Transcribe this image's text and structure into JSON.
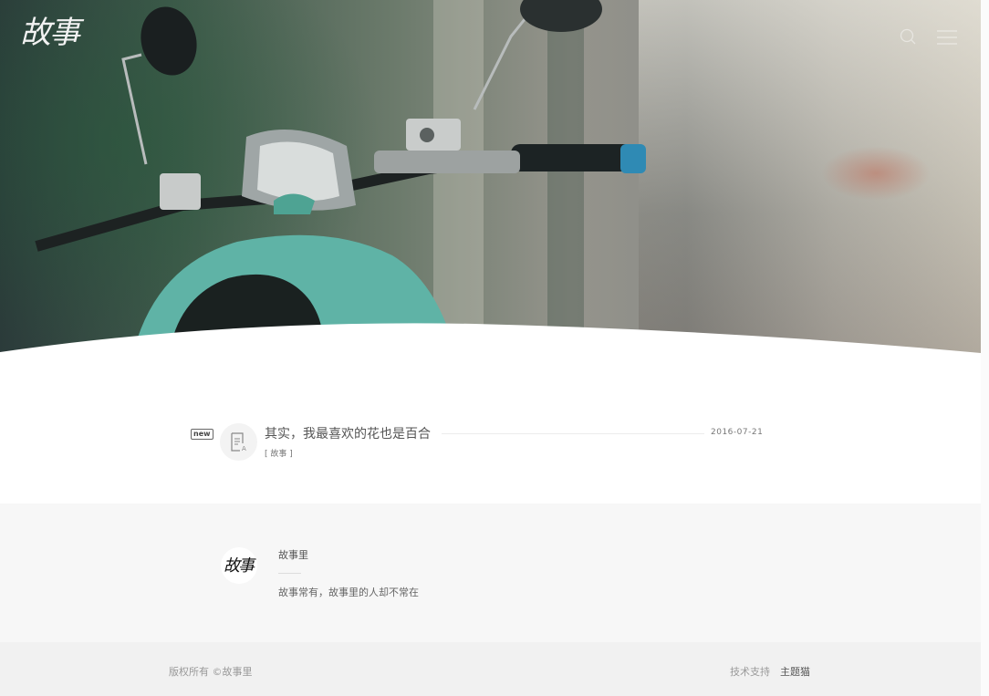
{
  "header": {
    "logo_text": "故事",
    "icons": [
      "search-icon",
      "menu-icon"
    ]
  },
  "post": {
    "badge": "new",
    "title": "其实，我最喜欢的花也是百合",
    "date": "2016-07-21",
    "category": "[ 故事 ]",
    "icon": "article-icon"
  },
  "author": {
    "avatar_text": "故事",
    "name": "故事里",
    "description": "故事常有，故事里的人却不常在"
  },
  "footer": {
    "copyright": "版权所有 ©故事里",
    "support_label": "技术支持",
    "support_link": "主题猫"
  },
  "colors": {
    "accent_teal": "#5fb3a6",
    "footer_bg": "#f1f1f1",
    "band_bg": "#f7f7f7"
  }
}
